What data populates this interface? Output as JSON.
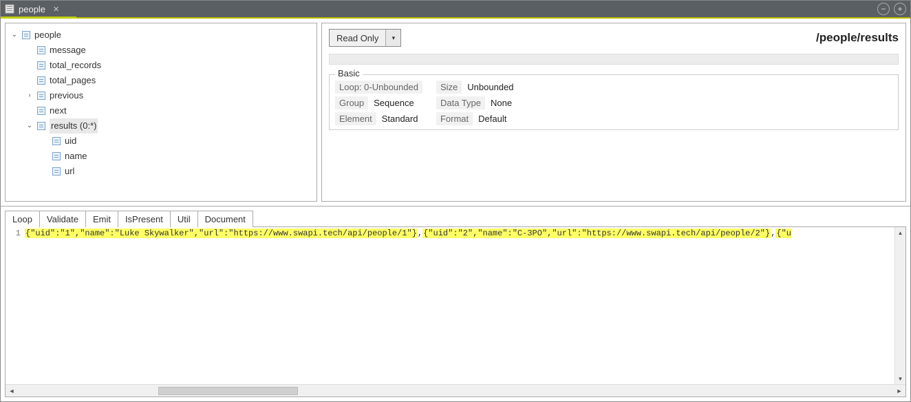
{
  "titlebar": {
    "tab_label": "people"
  },
  "tree": {
    "root": {
      "label": "people",
      "children": [
        {
          "label": "message"
        },
        {
          "label": "total_records"
        },
        {
          "label": "total_pages"
        },
        {
          "label": "previous"
        },
        {
          "label": "next"
        },
        {
          "label": "results (0:*)",
          "selected": true,
          "children": [
            {
              "label": "uid"
            },
            {
              "label": "name"
            },
            {
              "label": "url"
            }
          ]
        }
      ]
    }
  },
  "props": {
    "mode": "Read Only",
    "path": "/people/results",
    "section_title": "Basic",
    "loop_label": "Loop:",
    "loop_value": "0-Unbounded",
    "size_label": "Size",
    "size_value": "Unbounded",
    "group_label": "Group",
    "group_value": "Sequence",
    "datatype_label": "Data Type",
    "datatype_value": "None",
    "element_label": "Element",
    "element_value": "Standard",
    "format_label": "Format",
    "format_value": "Default"
  },
  "tabs": {
    "items": [
      "Loop",
      "Validate",
      "Emit",
      "IsPresent",
      "Util",
      "Document"
    ],
    "active_index": 5
  },
  "editor": {
    "line_number": "1",
    "segments": [
      {
        "hl": true,
        "text": "{\"uid\":\"1\",\"name\":\"Luke Skywalker\",\"url\":\"https://www.swapi.tech/api/people/1\"}"
      },
      {
        "hl": false,
        "text": ","
      },
      {
        "hl": true,
        "text": "{\"uid\":\"2\",\"name\":\"C-3PO\",\"url\":\"https://www.swapi.tech/api/people/2\"}"
      },
      {
        "hl": false,
        "text": ","
      },
      {
        "hl": true,
        "text": "{\"u"
      }
    ]
  }
}
